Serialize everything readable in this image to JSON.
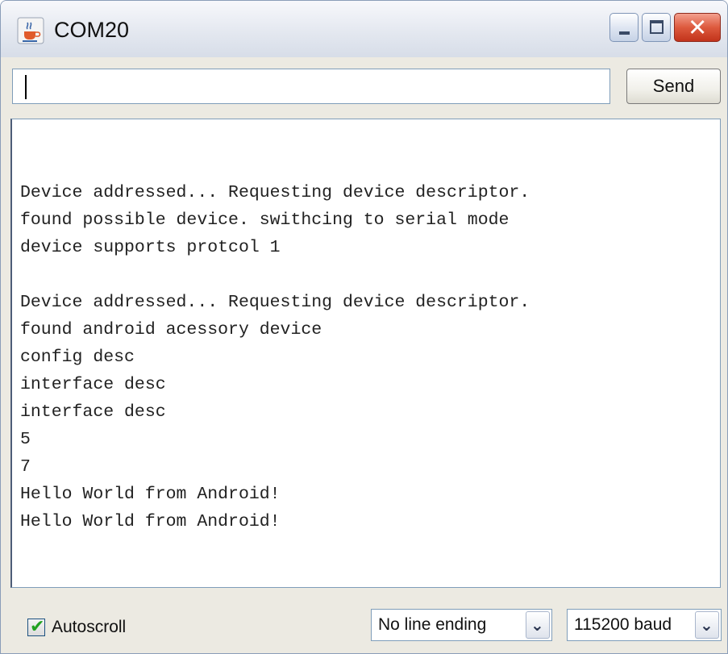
{
  "window": {
    "title": "COM20",
    "close_symbol": "✕",
    "icons": {
      "app": "java-coffee-cup-icon",
      "minimize": "minimize-icon",
      "maximize": "maximize-icon",
      "close": "close-icon"
    }
  },
  "input": {
    "value": "",
    "send_label": "Send"
  },
  "output": {
    "text": "Device addressed... Requesting device descriptor.\nfound possible device. swithcing to serial mode\ndevice supports protcol 1\n\nDevice addressed... Requesting device descriptor.\nfound android acessory device\nconfig desc\ninterface desc\ninterface desc\n5\n7\nHello World from Android!\nHello World from Android!"
  },
  "statusbar": {
    "autoscroll_label": "Autoscroll",
    "autoscroll_checked": true,
    "check_symbol": "✔",
    "line_ending": "No line ending",
    "baud_rate": "115200 baud",
    "dropdown_symbol": "⌄"
  },
  "colors": {
    "close_button": "#d4492e",
    "titlebar": "#e4e8f0",
    "window_background": "#eceae2",
    "output_background": "#ffffff",
    "checkmark": "#21a121"
  }
}
